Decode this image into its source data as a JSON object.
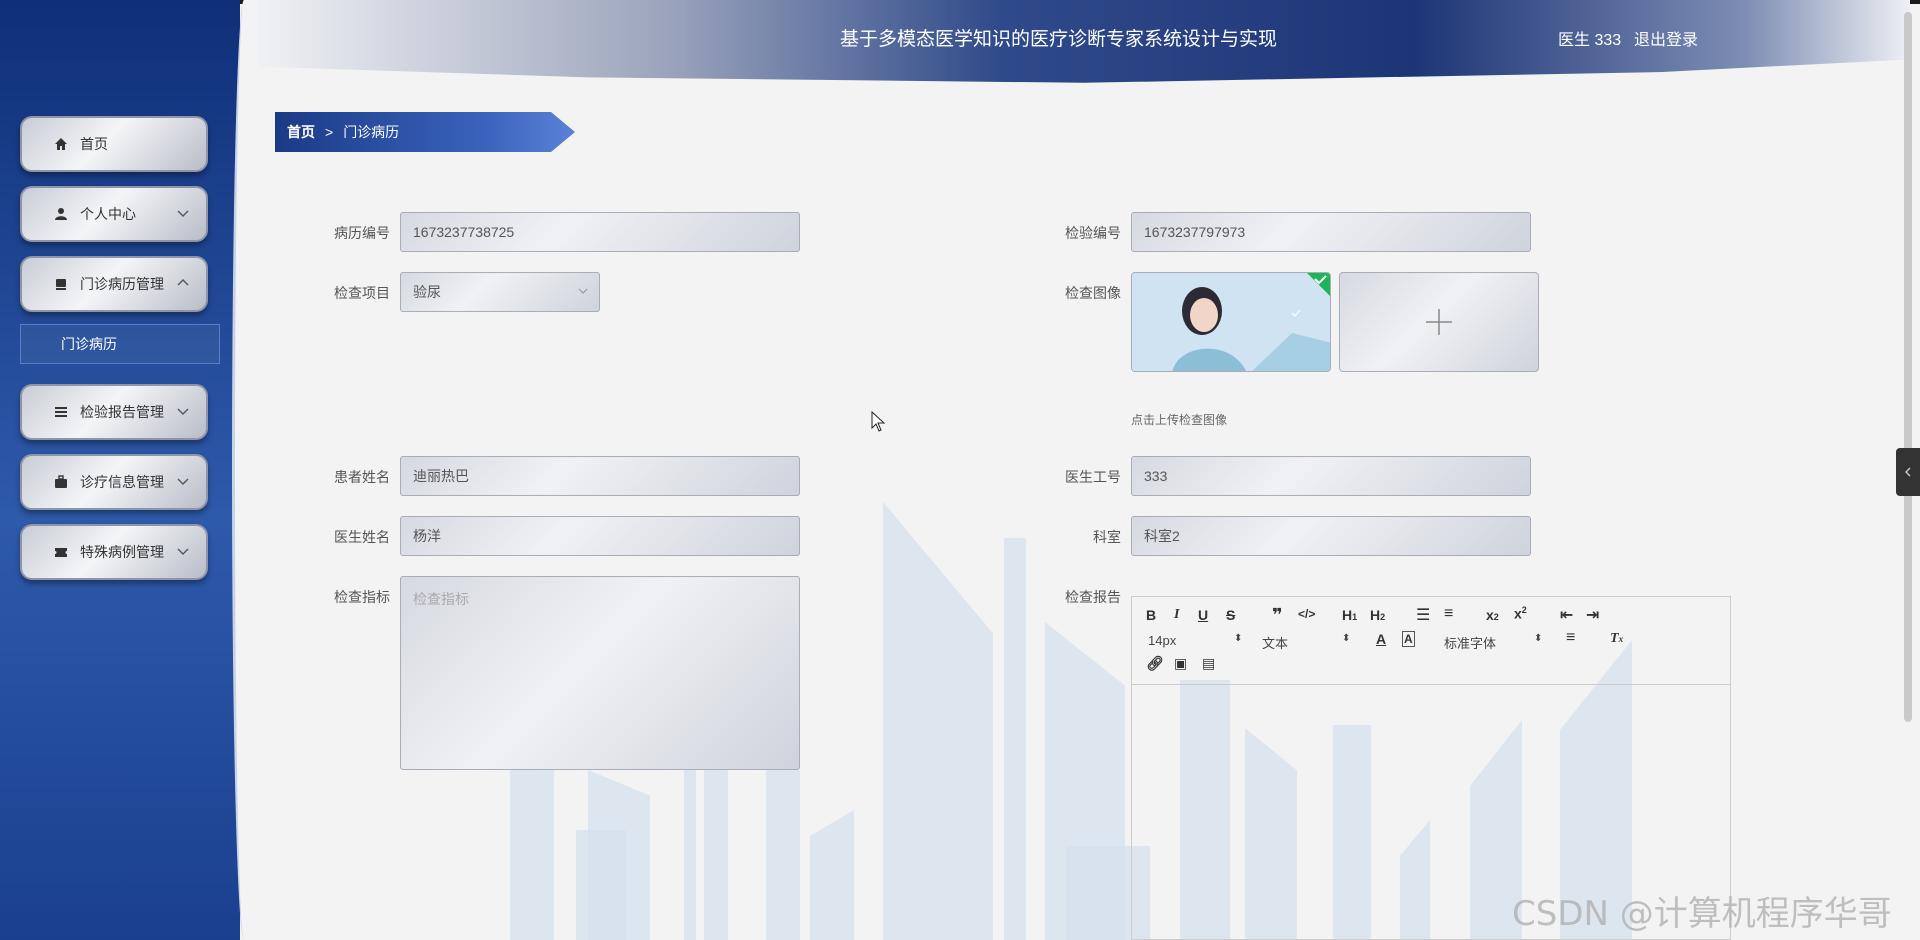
{
  "header": {
    "title": "基于多模态医学知识的医疗诊断专家系统设计与实现",
    "user": "医生 333",
    "logout": "退出登录"
  },
  "sidebar": {
    "items": [
      {
        "label": "首页",
        "icon": "home-icon"
      },
      {
        "label": "个人中心",
        "icon": "user-icon"
      },
      {
        "label": "门诊病历管理",
        "icon": "record-icon"
      },
      {
        "label": "检验报告管理",
        "icon": "list-icon"
      },
      {
        "label": "诊疗信息管理",
        "icon": "briefcase-icon"
      },
      {
        "label": "特殊病例管理",
        "icon": "ticket-icon"
      }
    ],
    "submenu": "门诊病历"
  },
  "breadcrumb": {
    "home": "首页",
    "sep": ">",
    "current": "门诊病历"
  },
  "form": {
    "record_no_label": "病历编号",
    "record_no": "1673237738725",
    "exam_no_label": "检验编号",
    "exam_no": "1673237797973",
    "exam_item_label": "检查项目",
    "exam_item": "验尿",
    "exam_image_label": "检查图像",
    "upload_tip": "点击上传检查图像",
    "patient_label": "患者姓名",
    "patient": "迪丽热巴",
    "doctor_id_label": "医生工号",
    "doctor_id": "333",
    "doctor_name_label": "医生姓名",
    "doctor_name": "杨洋",
    "dept_label": "科室",
    "dept": "科室2",
    "indicator_label": "检查指标",
    "indicator_placeholder": "检查指标",
    "report_label": "检查报告"
  },
  "editor": {
    "font_size": "14px",
    "block_type": "文本",
    "font_family": "标准字体"
  },
  "watermark": "CSDN @计算机程序华哥"
}
